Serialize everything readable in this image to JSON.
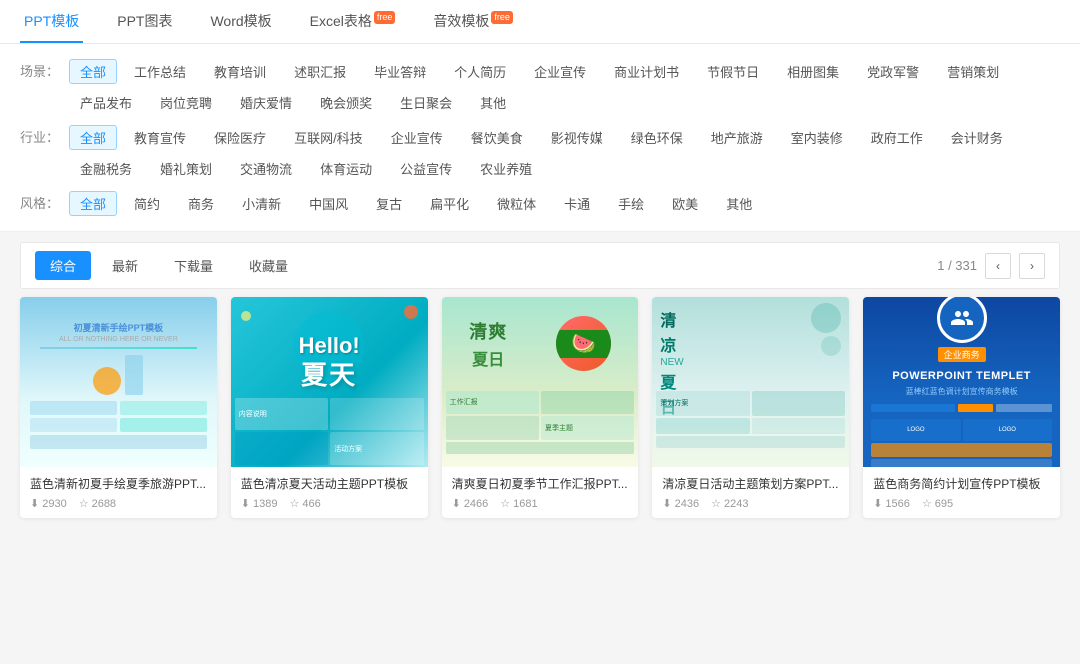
{
  "topNav": {
    "items": [
      {
        "label": "PPT模板",
        "active": true,
        "badge": ""
      },
      {
        "label": "PPT图表",
        "active": false,
        "badge": ""
      },
      {
        "label": "Word模板",
        "active": false,
        "badge": ""
      },
      {
        "label": "Excel表格",
        "active": false,
        "badge": "free"
      },
      {
        "label": "音效模板",
        "active": false,
        "badge": "free"
      }
    ]
  },
  "filters": {
    "scene": {
      "label": "场景：",
      "items": [
        {
          "label": "全部",
          "active": true
        },
        {
          "label": "工作总结",
          "active": false
        },
        {
          "label": "教育培训",
          "active": false
        },
        {
          "label": "述职汇报",
          "active": false
        },
        {
          "label": "毕业答辩",
          "active": false
        },
        {
          "label": "个人简历",
          "active": false
        },
        {
          "label": "企业宣传",
          "active": false
        },
        {
          "label": "商业计划书",
          "active": false
        },
        {
          "label": "节假节日",
          "active": false
        },
        {
          "label": "相册图集",
          "active": false
        },
        {
          "label": "党政军警",
          "active": false
        },
        {
          "label": "营销策划",
          "active": false
        },
        {
          "label": "产品发布",
          "active": false
        },
        {
          "label": "岗位竞聘",
          "active": false
        },
        {
          "label": "婚庆爱情",
          "active": false
        },
        {
          "label": "晚会颁奖",
          "active": false
        },
        {
          "label": "生日聚会",
          "active": false
        },
        {
          "label": "其他",
          "active": false
        }
      ]
    },
    "industry": {
      "label": "行业：",
      "items": [
        {
          "label": "全部",
          "active": true
        },
        {
          "label": "教育宣传",
          "active": false
        },
        {
          "label": "保险医疗",
          "active": false
        },
        {
          "label": "互联网/科技",
          "active": false
        },
        {
          "label": "企业宣传",
          "active": false
        },
        {
          "label": "餐饮美食",
          "active": false
        },
        {
          "label": "影视传媒",
          "active": false
        },
        {
          "label": "绿色环保",
          "active": false
        },
        {
          "label": "地产旅游",
          "active": false
        },
        {
          "label": "室内装修",
          "active": false
        },
        {
          "label": "政府工作",
          "active": false
        },
        {
          "label": "会计财务",
          "active": false
        },
        {
          "label": "金融税务",
          "active": false
        },
        {
          "label": "婚礼策划",
          "active": false
        },
        {
          "label": "交通物流",
          "active": false
        },
        {
          "label": "体育运动",
          "active": false
        },
        {
          "label": "公益宣传",
          "active": false
        },
        {
          "label": "农业养殖",
          "active": false
        }
      ]
    },
    "style": {
      "label": "风格：",
      "items": [
        {
          "label": "全部",
          "active": true
        },
        {
          "label": "简约",
          "active": false
        },
        {
          "label": "商务",
          "active": false
        },
        {
          "label": "小清新",
          "active": false
        },
        {
          "label": "中国风",
          "active": false
        },
        {
          "label": "复古",
          "active": false
        },
        {
          "label": "扁平化",
          "active": false
        },
        {
          "label": "微粒体",
          "active": false
        },
        {
          "label": "卡通",
          "active": false
        },
        {
          "label": "手绘",
          "active": false
        },
        {
          "label": "欧美",
          "active": false
        },
        {
          "label": "其他",
          "active": false
        }
      ]
    }
  },
  "sortBar": {
    "tabs": [
      {
        "label": "综合",
        "active": true
      },
      {
        "label": "最新",
        "active": false
      },
      {
        "label": "下载量",
        "active": false
      },
      {
        "label": "收藏量",
        "active": false
      }
    ],
    "pagination": "1 / 331"
  },
  "cards": [
    {
      "title": "蓝色清新初夏手绘夏季旅游PPT...",
      "downloads": "2930",
      "favorites": "2688",
      "theme": "card1"
    },
    {
      "title": "蓝色清凉夏天活动主题PPT模板",
      "downloads": "1389",
      "favorites": "466",
      "theme": "card2"
    },
    {
      "title": "清爽夏日初夏季节工作汇报PPT...",
      "downloads": "2466",
      "favorites": "1681",
      "theme": "card3"
    },
    {
      "title": "清凉夏日活动主题策划方案PPT...",
      "downloads": "2436",
      "favorites": "2243",
      "theme": "card4"
    },
    {
      "title": "蓝色商务简约计划宣传PPT模板",
      "downloads": "1566",
      "favorites": "695",
      "theme": "card5"
    }
  ],
  "icons": {
    "download": "⬇",
    "star": "☆",
    "chevron_left": "‹",
    "chevron_right": "›"
  }
}
